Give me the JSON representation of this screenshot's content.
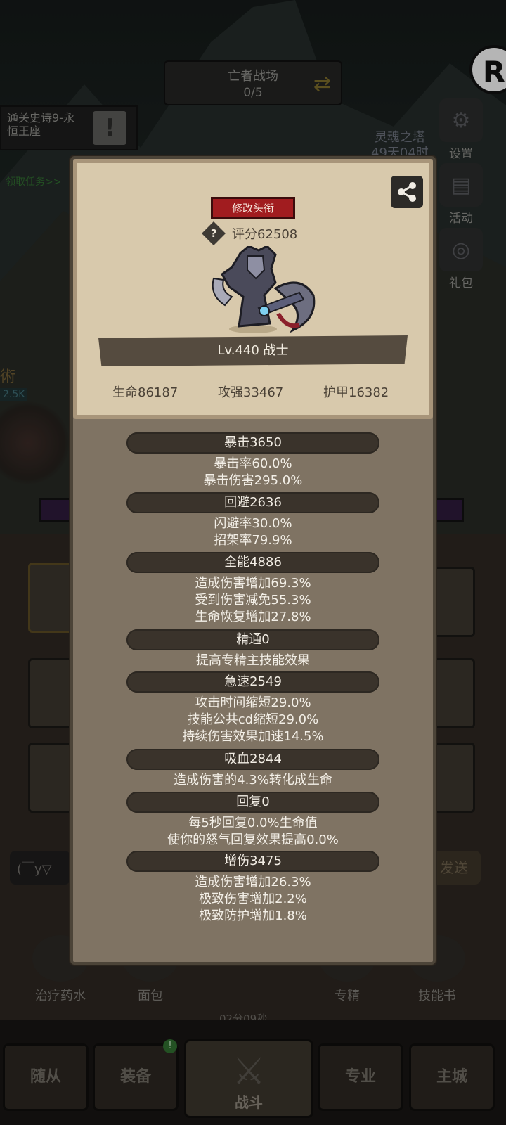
{
  "background": {
    "top_pill": {
      "title": "亡者战场",
      "progress": "0/5"
    },
    "quest": {
      "text_line1": "通关史诗9-永",
      "text_line2": "恒王座",
      "link": "领取任务>>"
    },
    "left_partial_word": "術",
    "left_partial_num": "2.5K",
    "tower": {
      "line1": "灵魂之塔",
      "line2": "49天04时"
    },
    "right_icons": [
      {
        "label": "设置",
        "icon": "gear-icon"
      },
      {
        "label": "活动",
        "icon": "calendar-icon"
      },
      {
        "label": "礼包",
        "icon": "coin-icon"
      }
    ],
    "chat_placeholder": "(￣y▽",
    "send_label": "发送",
    "skills": [
      {
        "label": "治疗药水"
      },
      {
        "label": "面包"
      },
      {
        "label": "专精"
      },
      {
        "label": "技能书"
      }
    ],
    "timer": "02分09秒",
    "nav": [
      "随从",
      "装备",
      "战斗",
      "专业",
      "主城"
    ],
    "nav_badge": "!"
  },
  "card": {
    "title_button": "修改头衔",
    "score": "评分62508",
    "help_glyph": "?",
    "level_class": "Lv.440 战士",
    "hp": "生命86187",
    "attack": "攻强33467",
    "armor": "护甲16382"
  },
  "stats": [
    {
      "header": "暴击3650",
      "lines": [
        "暴击率60.0%",
        "暴击伤害295.0%"
      ]
    },
    {
      "header": "回避2636",
      "lines": [
        "闪避率30.0%",
        "招架率79.9%"
      ]
    },
    {
      "header": "全能4886",
      "lines": [
        "造成伤害增加69.3%",
        "受到伤害减免55.3%",
        "生命恢复增加27.8%"
      ]
    },
    {
      "header": "精通0",
      "lines": [
        "提高专精主技能效果"
      ]
    },
    {
      "header": "急速2549",
      "lines": [
        "攻击时间缩短29.0%",
        "技能公共cd缩短29.0%",
        "持续伤害效果加速14.5%"
      ]
    },
    {
      "header": "吸血2844",
      "lines": [
        "造成伤害的4.3%转化成生命"
      ]
    },
    {
      "header": "回复0",
      "lines": [
        "每5秒回复0.0%生命值",
        "使你的怒气回复效果提高0.0%"
      ]
    },
    {
      "header": "增伤3475",
      "lines": [
        "造成伤害增加26.3%",
        "极致伤害增加2.2%",
        "极致防护增加1.8%"
      ]
    }
  ],
  "colors": {
    "panel": "#7f7363",
    "card": "#d8c9ac",
    "ribbon": "#3a332b",
    "title_button": "#a11c1f"
  }
}
